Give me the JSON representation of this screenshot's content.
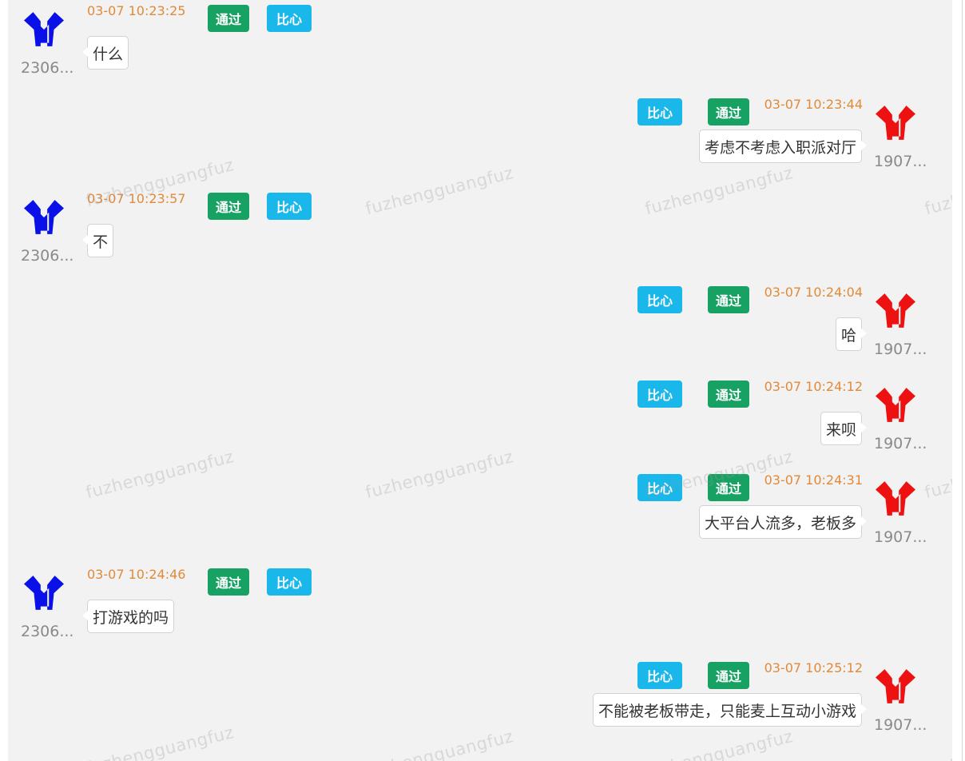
{
  "watermark_text": "fuzhengguangfuz",
  "colors": {
    "pass_button": "#17a263",
    "like_button": "#1ab7ea",
    "timestamp": "#e08a3a",
    "left_avatar": "#0a10e8",
    "right_avatar": "#ee1111"
  },
  "icons": {
    "left_avatar": "user-avatar-blue-icon",
    "right_avatar": "user-avatar-red-icon"
  },
  "messages": [
    {
      "side": "left",
      "user": "2306...",
      "time": "03-07 10:23:25",
      "pass_label": "通过",
      "like_label": "比心",
      "text": "什么"
    },
    {
      "side": "right",
      "user": "1907...",
      "time": "03-07 10:23:44",
      "pass_label": "通过",
      "like_label": "比心",
      "text": "考虑不考虑入职派对厅"
    },
    {
      "side": "left",
      "user": "2306...",
      "time": "03-07 10:23:57",
      "pass_label": "通过",
      "like_label": "比心",
      "text": "不"
    },
    {
      "side": "right",
      "user": "1907...",
      "time": "03-07 10:24:04",
      "pass_label": "通过",
      "like_label": "比心",
      "text": "哈"
    },
    {
      "side": "right",
      "user": "1907...",
      "time": "03-07 10:24:12",
      "pass_label": "通过",
      "like_label": "比心",
      "text": "来呗"
    },
    {
      "side": "right",
      "user": "1907...",
      "time": "03-07 10:24:31",
      "pass_label": "通过",
      "like_label": "比心",
      "text": "大平台人流多，老板多"
    },
    {
      "side": "left",
      "user": "2306...",
      "time": "03-07 10:24:46",
      "pass_label": "通过",
      "like_label": "比心",
      "text": "打游戏的吗"
    },
    {
      "side": "right",
      "user": "1907...",
      "time": "03-07 10:25:12",
      "pass_label": "通过",
      "like_label": "比心",
      "text": "不能被老板带走，只能麦上互动小游戏"
    }
  ]
}
